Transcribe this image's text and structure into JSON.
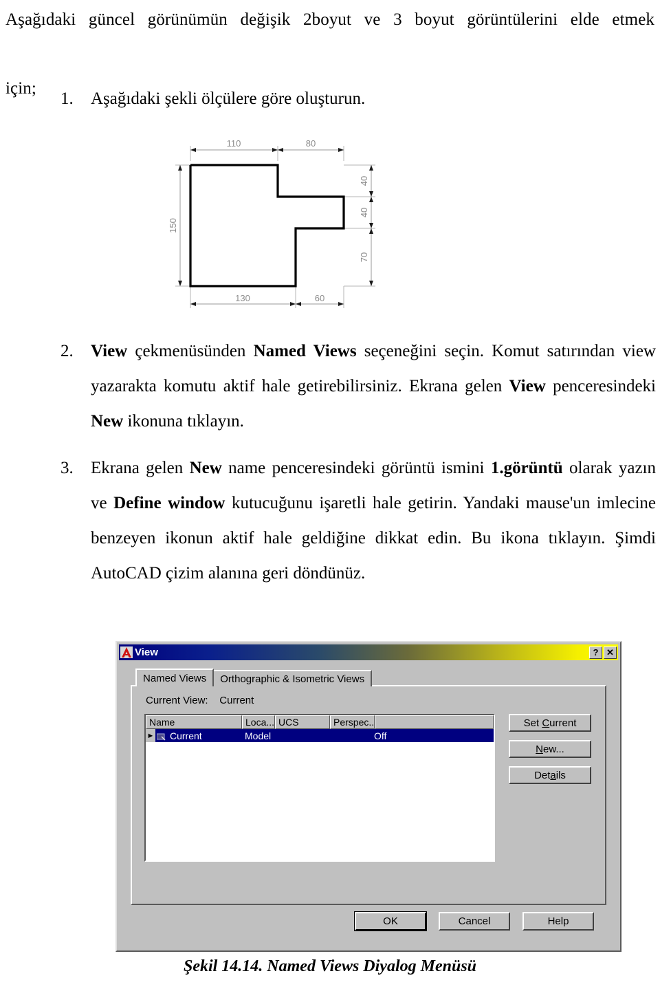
{
  "intro": {
    "line1": "Aşağıdaki güncel görünümün değişik 2boyut ve 3 boyut görüntülerini elde etmek",
    "line2": "için;"
  },
  "steps": [
    {
      "number": "1.",
      "lines": [
        "Aşağıdaki şekli ölçülere göre oluşturun."
      ]
    },
    {
      "number": "2.",
      "segments": [
        {
          "t": "View",
          "b": true
        },
        {
          "t": " çekmenüsünden ",
          "b": false
        },
        {
          "t": "Named Views",
          "b": true
        },
        {
          "t": " seçeneğini seçin. Komut satırından view yazarakta  komutu aktif hale getirebilirsiniz. Ekrana gelen ",
          "b": false
        },
        {
          "t": "View",
          "b": true
        },
        {
          "t": " penceresindeki ",
          "b": false
        },
        {
          "t": "New",
          "b": true
        },
        {
          "t": " ikonuna tıklayın.",
          "b": false
        }
      ]
    },
    {
      "number": "3.",
      "segments": [
        {
          "t": "Ekrana gelen ",
          "b": false
        },
        {
          "t": "New",
          "b": true
        },
        {
          "t": " name penceresindeki görüntü ismini ",
          "b": false
        },
        {
          "t": "1.görüntü",
          "b": true
        },
        {
          "t": " olarak yazın ve ",
          "b": false
        },
        {
          "t": "Define window",
          "b": true
        },
        {
          "t": " kutucuğunu işaretli hale getirin. Yandaki mause'un imlecine benzeyen ikonun aktif hale geldiğine dikkat edin. Bu ikona tıklayın. Şimdi AutoCAD çizim alanına geri döndünüz.",
          "b": false
        }
      ]
    }
  ],
  "drawing": {
    "dimensions": {
      "top_left": "110",
      "top_right": "80",
      "left": "150",
      "right_top": "40",
      "right_middle": "40",
      "right_bottom": "70",
      "bottom_left": "130",
      "bottom_right": "60"
    },
    "outline_color": "#000000",
    "dimension_color": "#999999"
  },
  "dialog": {
    "title": "View",
    "title_icon": "autocad-a-icon",
    "help_button": "?",
    "close_button": "✕",
    "tabs": [
      {
        "label": "Named Views",
        "active": true
      },
      {
        "label": "Orthographic & Isometric Views",
        "active": false
      }
    ],
    "current_view_label": "Current View:",
    "current_view_value": "Current",
    "list": {
      "columns": [
        "Name",
        "Loca...",
        "UCS",
        "Perspec...",
        ""
      ],
      "rows": [
        {
          "name": "Current",
          "location": "Model",
          "ucs": "",
          "perspective": "Off",
          "selected": true
        }
      ]
    },
    "side_buttons": [
      {
        "label": "Set Current",
        "accel_index": 4
      },
      {
        "label": "New...",
        "accel_index": 0
      },
      {
        "label": "Details",
        "accel_index": 3
      }
    ],
    "bottom_buttons": [
      {
        "label": "OK",
        "default": true
      },
      {
        "label": "Cancel",
        "default": false
      },
      {
        "label": "Help",
        "default": false
      }
    ],
    "colors": {
      "face": "#c0c0c0",
      "titlebar_start": "#00007e",
      "titlebar_end": "#ffff00",
      "selection": "#000080"
    }
  },
  "caption": "Şekil 14.14. Named Views Diyalog Menüsü"
}
